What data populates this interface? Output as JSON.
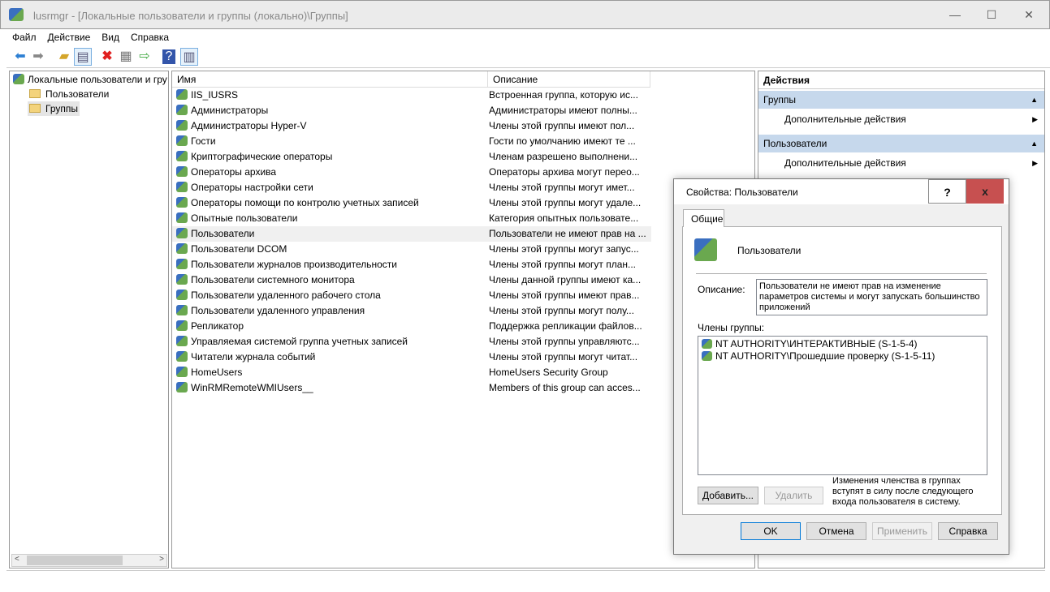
{
  "window": {
    "title": "lusrmgr - [Локальные пользователи и группы (локально)\\Группы]",
    "minimize": "—",
    "maximize": "☐",
    "close": "✕"
  },
  "menu": [
    "Файл",
    "Действие",
    "Вид",
    "Справка"
  ],
  "toolbar": {
    "icons": [
      "back-icon",
      "forward-icon",
      "up-folder-icon",
      "show-tree-icon",
      "delete-icon",
      "properties-icon",
      "export-icon",
      "help-icon",
      "show-action-pane-icon"
    ]
  },
  "tree": {
    "root": "Локальные пользователи и группы (локально)",
    "items": [
      "Пользователи",
      "Группы"
    ],
    "selected": "Группы"
  },
  "list": {
    "columns": [
      "Имя",
      "Описание"
    ],
    "rows": [
      {
        "name": "IIS_IUSRS",
        "desc": "Встроенная группа, которую ис..."
      },
      {
        "name": "Администраторы",
        "desc": "Администраторы имеют полны..."
      },
      {
        "name": "Администраторы Hyper-V",
        "desc": "Члены этой группы имеют пол..."
      },
      {
        "name": "Гости",
        "desc": "Гости по умолчанию имеют те ..."
      },
      {
        "name": "Криптографические операторы",
        "desc": "Членам разрешено выполнени..."
      },
      {
        "name": "Операторы архива",
        "desc": "Операторы архива могут перео..."
      },
      {
        "name": "Операторы настройки сети",
        "desc": "Члены этой группы могут имет..."
      },
      {
        "name": "Операторы помощи по контролю учетных записей",
        "desc": "Члены этой группы могут удале..."
      },
      {
        "name": "Опытные пользователи",
        "desc": "Категория опытных пользовате..."
      },
      {
        "name": "Пользователи",
        "desc": "Пользователи не имеют прав на ..."
      },
      {
        "name": "Пользователи DCOM",
        "desc": "Члены этой группы могут запус..."
      },
      {
        "name": "Пользователи журналов производительности",
        "desc": "Члены этой группы могут план..."
      },
      {
        "name": "Пользователи системного монитора",
        "desc": "Члены данной группы имеют ка..."
      },
      {
        "name": "Пользователи удаленного рабочего стола",
        "desc": "Члены этой группы имеют прав..."
      },
      {
        "name": "Пользователи удаленного управления",
        "desc": "Члены этой группы могут полу..."
      },
      {
        "name": "Репликатор",
        "desc": "Поддержка репликации файлов..."
      },
      {
        "name": "Управляемая системой группа учетных записей",
        "desc": "Члены этой группы управляютс..."
      },
      {
        "name": "Читатели журнала событий",
        "desc": "Члены этой группы могут читат..."
      },
      {
        "name": "HomeUsers",
        "desc": "HomeUsers Security Group"
      },
      {
        "name": "WinRMRemoteWMIUsers__",
        "desc": "Members of this group can acces..."
      }
    ],
    "selected_index": 9
  },
  "actions": {
    "title": "Действия",
    "sections": [
      {
        "label": "Группы",
        "item": "Дополнительные действия"
      },
      {
        "label": "Пользователи",
        "item": "Дополнительные действия"
      }
    ]
  },
  "dialog": {
    "title": "Свойства: Пользователи",
    "help": "?",
    "close": "x",
    "tab": "Общие",
    "group_name": "Пользователи",
    "desc_label": "Описание:",
    "desc": "Пользователи не имеют прав на изменение параметров системы и могут запускать большинство приложений",
    "members_label": "Члены группы:",
    "members": [
      "NT AUTHORITY\\ИНТЕРАКТИВНЫЕ (S-1-5-4)",
      "NT AUTHORITY\\Прошедшие проверку (S-1-5-11)"
    ],
    "add": "Добавить...",
    "remove": "Удалить",
    "note": "Изменения членства в группах вступят в силу после следующего входа пользователя в систему.",
    "ok": "OK",
    "cancel": "Отмена",
    "apply": "Применить",
    "help_btn": "Справка"
  },
  "colors": {
    "accent": "#c6d8ec",
    "close_red": "#c75050"
  }
}
